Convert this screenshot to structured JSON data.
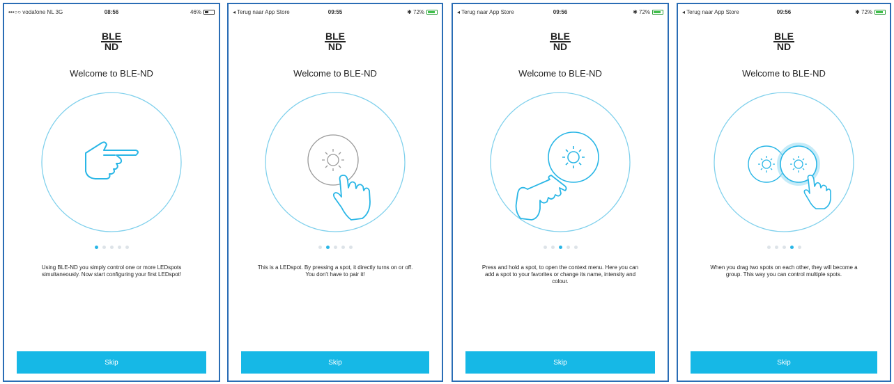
{
  "screens": [
    {
      "status_left": "•••○○ vodafone NL  3G",
      "time": "08:56",
      "status_right": "46%",
      "logo": [
        "BLE",
        "ND"
      ],
      "welcome": "Welcome to BLE-ND",
      "description": "Using BLE-ND you simply control one or more LEDspots simultaneously. Now start configuring your first LEDspot!",
      "active_page": 1,
      "page_count": 5,
      "skip": "Skip"
    },
    {
      "status_left": "◂ Terug naar App Store",
      "time": "09:55",
      "status_right": "✱ 72%",
      "logo": [
        "BLE",
        "ND"
      ],
      "welcome": "Welcome to BLE-ND",
      "description": "This is a LEDspot. By pressing a spot, it directly turns on or off. You don't have to pair it!",
      "active_page": 2,
      "page_count": 5,
      "skip": "Skip"
    },
    {
      "status_left": "◂ Terug naar App Store",
      "time": "09:56",
      "status_right": "✱ 72%",
      "logo": [
        "BLE",
        "ND"
      ],
      "welcome": "Welcome to BLE-ND",
      "description": "Press and hold a spot, to open the context menu. Here you can add a spot to your favorites or change its name, intensity and colour.",
      "active_page": 3,
      "page_count": 5,
      "skip": "Skip"
    },
    {
      "status_left": "◂ Terug naar App Store",
      "time": "09:56",
      "status_right": "✱ 72%",
      "logo": [
        "BLE",
        "ND"
      ],
      "welcome": "Welcome to BLE-ND",
      "description": "When you drag two spots on each other, they will become a group. This way you can control multiple spots.",
      "active_page": 4,
      "page_count": 5,
      "skip": "Skip"
    }
  ],
  "colors": {
    "accent": "#16b8e6",
    "frame": "#2a6db5",
    "circle": "#7fd0ec"
  }
}
